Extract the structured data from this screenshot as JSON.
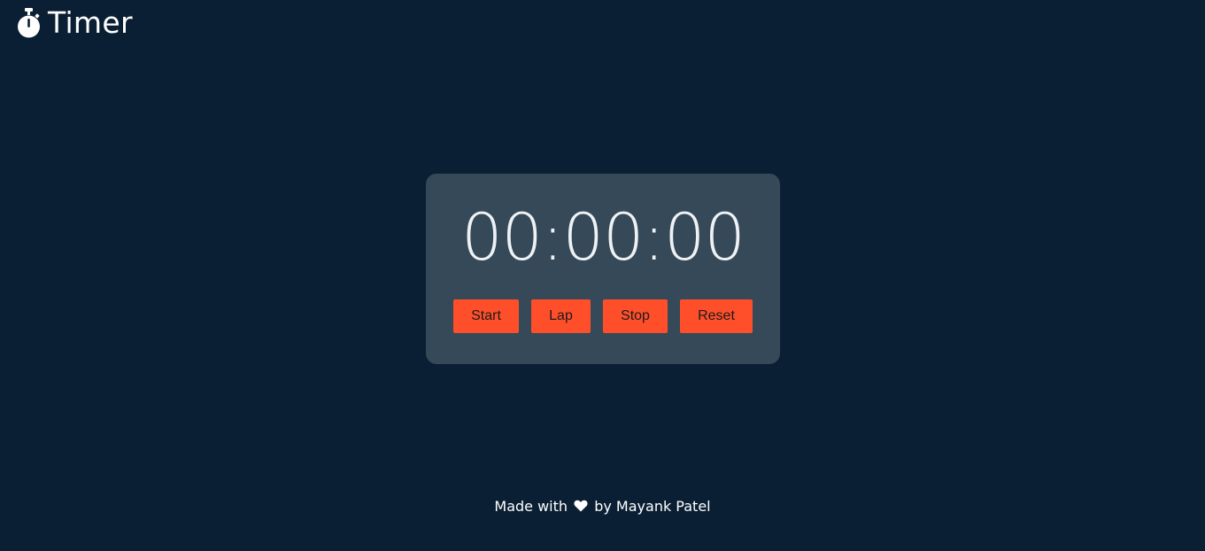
{
  "header": {
    "title": "Timer",
    "icon": "stopwatch-icon"
  },
  "timer": {
    "display": "00:00:00",
    "buttons": {
      "start": "Start",
      "lap": "Lap",
      "stop": "Stop",
      "reset": "Reset"
    }
  },
  "footer": {
    "made_with": "Made with",
    "by": "by Mayank Patel",
    "icon": "heart-icon"
  },
  "colors": {
    "background": "#0a1f33",
    "card": "#364959",
    "accent": "#ff4f2a",
    "text": "#ffffff"
  }
}
